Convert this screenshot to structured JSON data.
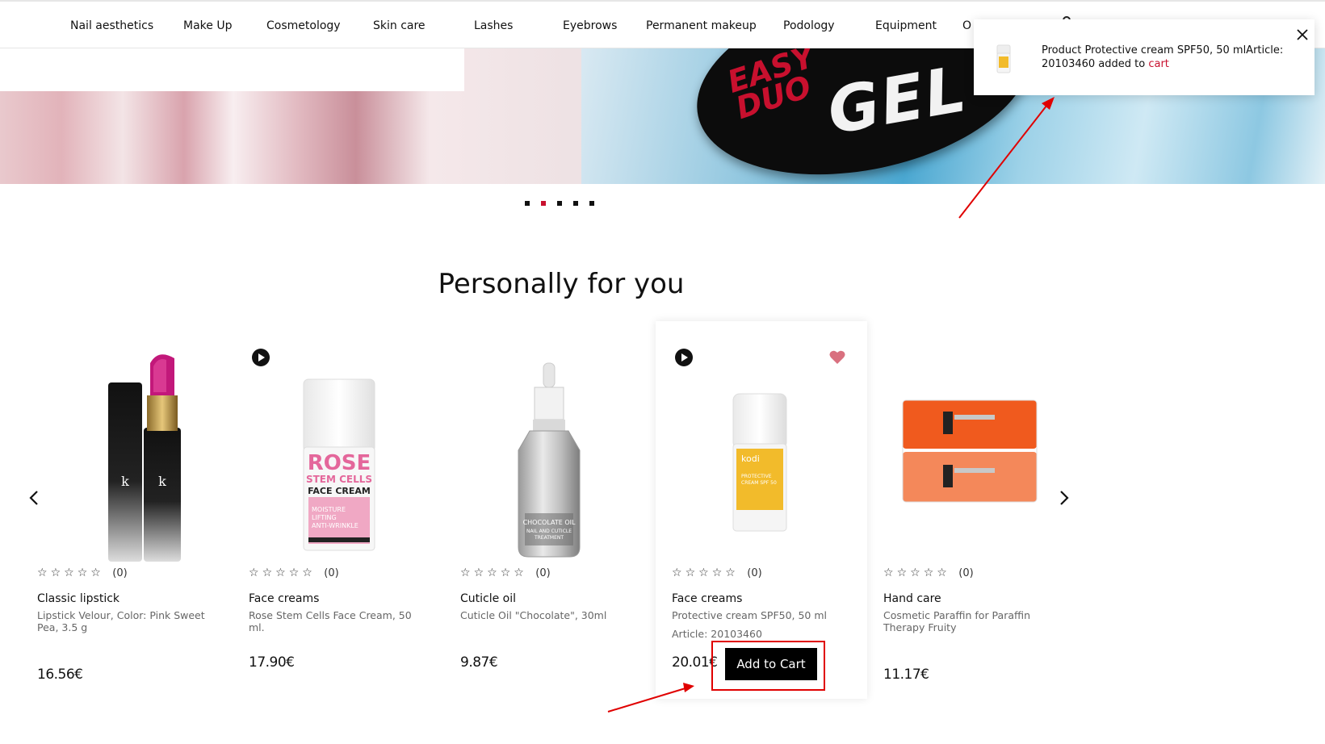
{
  "nav": {
    "items": [
      "Nail aesthetics",
      "Make Up",
      "Cosmetology",
      "Skin care",
      "Lashes",
      "Eyebrows",
      "Permanent makeup",
      "Podology",
      "Equipment",
      "O"
    ],
    "search_icon": "search-icon"
  },
  "banner": {
    "text_red": "EASY\nDUO",
    "text_white": "GEL",
    "slide_count": 5,
    "active_slide": 2,
    "accent_color": "#c8102e"
  },
  "section": {
    "title": "Personally for you"
  },
  "products": [
    {
      "category": "Classic lipstick",
      "name": "Lipstick Velour, Color: Pink Sweet Pea, 3.5 g",
      "price": "16.56€",
      "rating_count": "(0)"
    },
    {
      "category": "Face creams",
      "name": "Rose Stem Cells Face Cream, 50 ml.",
      "price": "17.90€",
      "rating_count": "(0)",
      "image_text": [
        "ROSE",
        "STEM CELLS",
        "FACE CREAM",
        "MOISTURE",
        "LIFTING",
        "ANTI-WRINKLE"
      ]
    },
    {
      "category": "Cuticle oil",
      "name": "Cuticle Oil \"Chocolate\", 30ml",
      "price": "9.87€",
      "rating_count": "(0)",
      "image_text": [
        "CHOCOLATE OIL",
        "NAIL AND CUTICLE",
        "TREATMENT"
      ]
    },
    {
      "category": "Face creams",
      "name": "Protective cream SPF50, 50 ml",
      "article": "Article: 20103460",
      "price": "20.01€",
      "rating_count": "(0)",
      "button": "Add to Cart",
      "image_text": [
        "kodi",
        "PROTECTIVE",
        "CREAM SPF 50"
      ]
    },
    {
      "category": "Hand care",
      "name": "Cosmetic Paraffin for Paraffin Therapy Fruity",
      "price": "11.17€",
      "rating_count": "(0)"
    }
  ],
  "toast": {
    "message": "Product Protective cream SPF50, 50 mlArticle: 20103460 added to ",
    "link": "cart"
  },
  "icons": [
    "search-icon",
    "play-icon",
    "heart-icon",
    "chevron-left-icon",
    "chevron-right-icon",
    "close-icon",
    "star-icon"
  ]
}
